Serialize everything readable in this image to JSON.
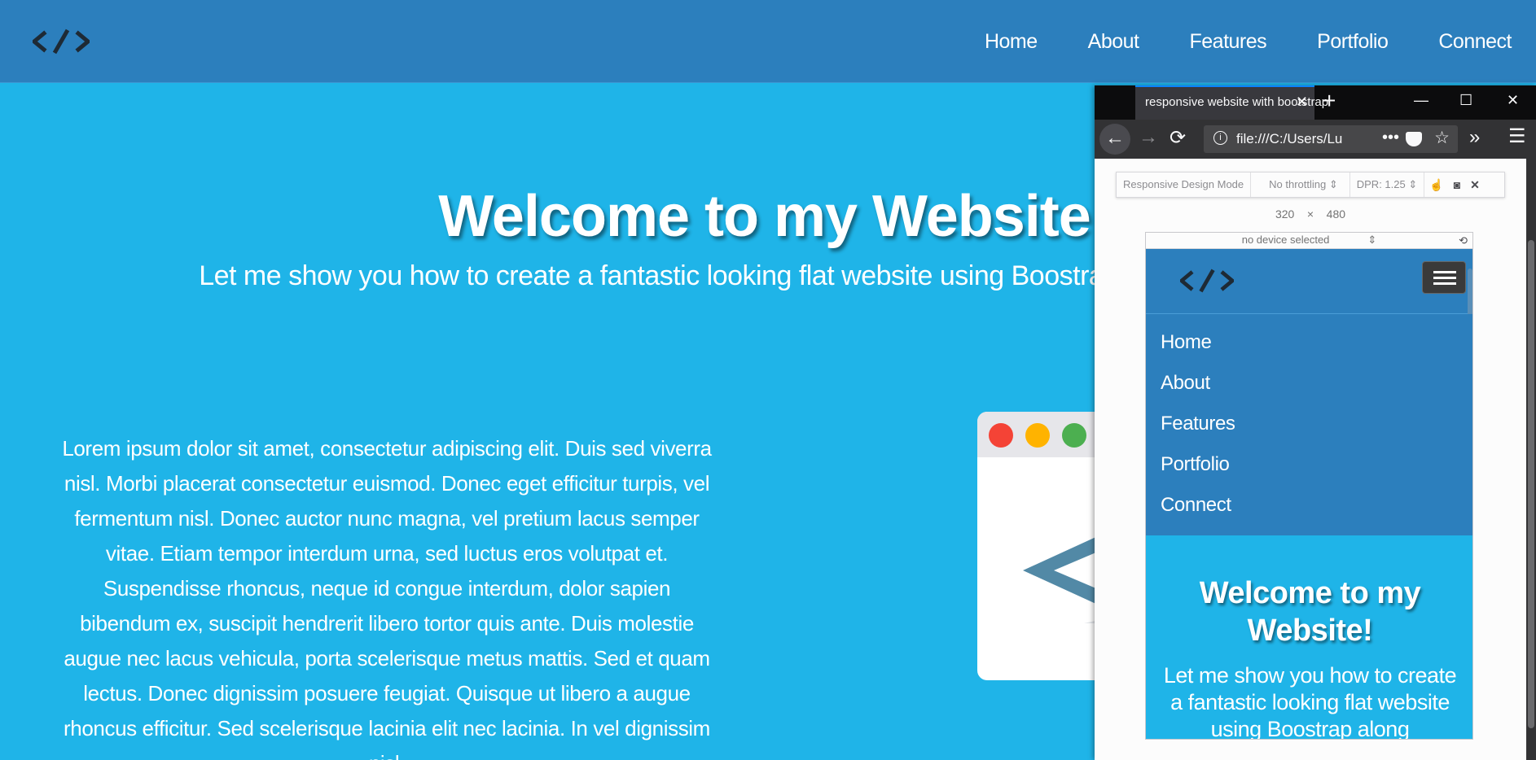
{
  "site": {
    "nav": {
      "logo_icon": "code-brackets-icon",
      "links": [
        "Home",
        "About",
        "Features",
        "Portfolio",
        "Connect"
      ]
    },
    "hero": {
      "title": "Welcome to my Website!",
      "subtitle": "Let me show you how to create a fantastic looking flat website using Boostrap and CSS snippets."
    },
    "body_text": "Lorem ipsum dolor sit amet, consectetur adipiscing elit. Duis sed viverra nisl. Morbi placerat consectetur euismod. Donec eget efficitur turpis, vel fermentum nisl. Donec auctor nunc magna, vel pretium lacus semper vitae. Etiam tempor interdum urna, sed luctus eros volutpat et. Suspendisse rhoncus, neque id congue interdum, dolor sapien bibendum ex, suscipit hendrerit libero tortor quis ante. Duis molestie augue nec lacus vehicula, porta scelerisque metus mattis. Sed et quam lectus. Donec dignissim posuere feugiat. Quisque ut libero a augue rhoncus efficitur. Sed scelerisque lacinia elit nec lacinia. In vel dignissim nisl."
  },
  "browser": {
    "tab_title": "responsive website with bootstrap",
    "url": "file:///C:/Users/Lu",
    "responsive_mode": {
      "label": "Responsive Design Mode",
      "throttling": "No throttling",
      "dpr": "DPR: 1.25",
      "width": "320",
      "times": "×",
      "height": "480",
      "device": "no device selected"
    }
  },
  "mobile": {
    "menu": [
      "Home",
      "About",
      "Features",
      "Portfolio",
      "Connect"
    ],
    "title": "Welcome to my Website!",
    "subtitle": "Let me show you how to create a fantastic looking flat website using Boostrap along"
  },
  "colors": {
    "nav_bg": "#2c7fbd",
    "page_bg": "#1fb4e8",
    "dot_red": "#f44336",
    "dot_yellow": "#ffb300",
    "dot_green": "#4caf50"
  }
}
